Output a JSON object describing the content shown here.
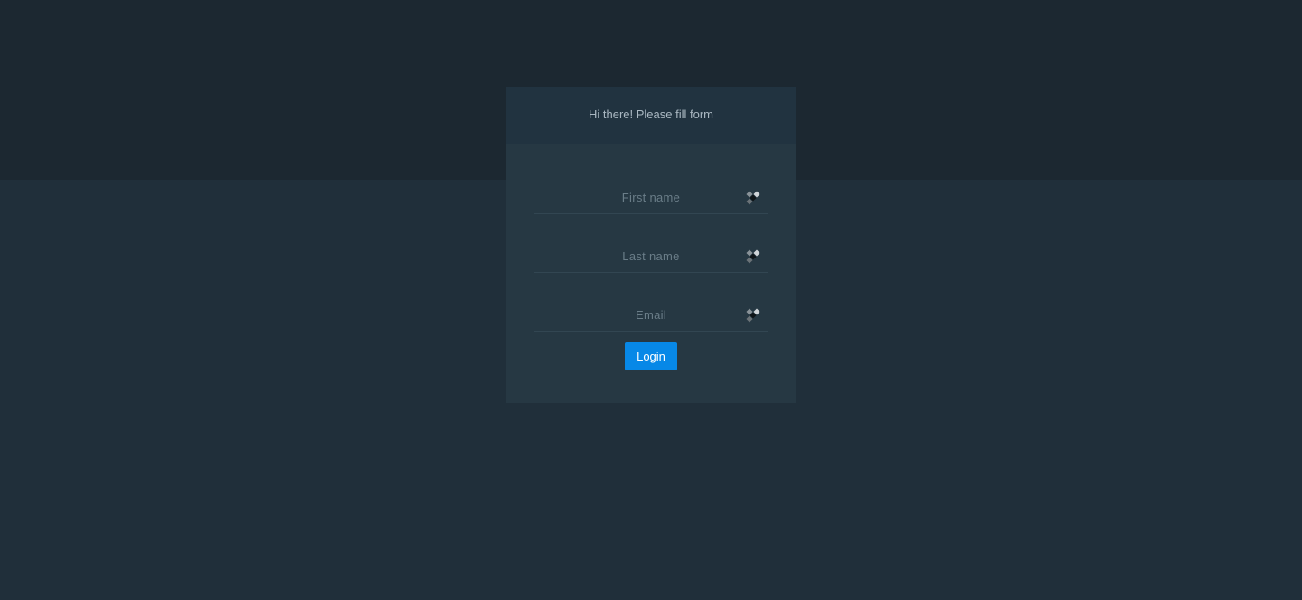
{
  "form": {
    "title": "Hi there! Please fill form",
    "fields": [
      {
        "placeholder": "First name",
        "value": "",
        "icon": "autofill-key-icon"
      },
      {
        "placeholder": "Last name",
        "value": "",
        "icon": "autofill-key-icon"
      },
      {
        "placeholder": "Email",
        "value": "",
        "icon": "autofill-key-icon"
      }
    ],
    "submit_label": "Login"
  },
  "colors": {
    "page_background": "#202f3a",
    "top_band": "#1c2831",
    "card_header": "#213340",
    "card_body": "#263843",
    "accent": "#0788e7"
  }
}
